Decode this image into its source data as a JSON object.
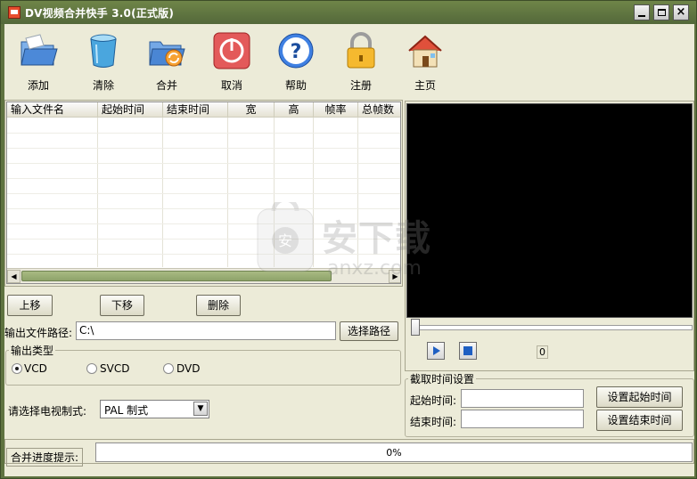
{
  "window": {
    "title": "DV视频合并快手 3.0(正式版)",
    "controls": [
      "minimize",
      "maximize",
      "close"
    ]
  },
  "toolbar": {
    "items": [
      {
        "label": "添加",
        "icon": "folder-icon"
      },
      {
        "label": "清除",
        "icon": "trash-can-icon"
      },
      {
        "label": "合并",
        "icon": "merge-folder-icon"
      },
      {
        "label": "取消",
        "icon": "power-icon"
      },
      {
        "label": "帮助",
        "icon": "help-icon"
      },
      {
        "label": "注册",
        "icon": "lock-icon"
      },
      {
        "label": "主页",
        "icon": "home-icon"
      }
    ]
  },
  "file_table": {
    "columns": [
      "输入文件名",
      "起始时间",
      "结束时间",
      "宽",
      "高",
      "帧率",
      "总帧数"
    ],
    "rows": []
  },
  "list_buttons": {
    "up": "上移",
    "down": "下移",
    "delete": "删除"
  },
  "output": {
    "path_label": "输出文件路径:",
    "path_value": "C:\\",
    "browse_button": "选择路径"
  },
  "output_type": {
    "title": "输出类型",
    "options": [
      "VCD",
      "SVCD",
      "DVD"
    ],
    "selected": "VCD"
  },
  "tv_standard": {
    "label": "请选择电视制式:",
    "selected": "PAL 制式"
  },
  "player": {
    "position_value": "0"
  },
  "clip_time": {
    "title": "截取时间设置",
    "start_label": "起始时间:",
    "end_label": "结束时间:",
    "start_value": "",
    "end_value": "",
    "set_start_button": "设置起始时间",
    "set_end_button": "设置结束时间"
  },
  "progress": {
    "label": "合并进度提示:",
    "value_text": "0%",
    "fraction": 0
  },
  "watermark": {
    "text": "安下载",
    "domain": "anxz.com"
  },
  "colors": {
    "window_frame": "#5f7340",
    "client_background": "#ecebd8",
    "video_background": "#000000",
    "progress_fill": "#3b7bd9"
  }
}
